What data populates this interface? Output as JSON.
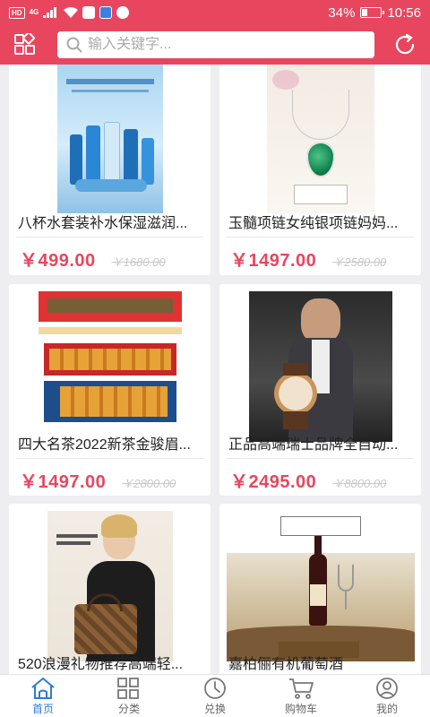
{
  "status_bar": {
    "hd": "HD",
    "network": "4G",
    "battery_percent": "34%",
    "battery_level": 0.34,
    "time": "10:56"
  },
  "header": {
    "search_placeholder": "输入关键字..."
  },
  "products": [
    {
      "title": "八杯水套装补水保湿滋润...",
      "price": "￥499.00",
      "old_price": "￥1680.00"
    },
    {
      "title": "玉髓项链女纯银项链妈妈...",
      "price": "￥1497.00",
      "old_price": "￥2580.00"
    },
    {
      "title": "四大名茶2022新茶金骏眉...",
      "price": "￥1497.00",
      "old_price": "￥2800.00"
    },
    {
      "title": "正品高端瑞士品牌全自动...",
      "price": "￥2495.00",
      "old_price": "￥8800.00"
    },
    {
      "title": "520浪漫礼物推荐高端轻...",
      "price": "",
      "old_price": ""
    },
    {
      "title": "嘉柏俪有机葡萄酒",
      "price": "",
      "old_price": ""
    }
  ],
  "bottom_nav": [
    {
      "label": "首页",
      "icon": "home-icon",
      "active": true
    },
    {
      "label": "分类",
      "icon": "category-icon",
      "active": false
    },
    {
      "label": "兑换",
      "icon": "exchange-icon",
      "active": false
    },
    {
      "label": "购物车",
      "icon": "cart-icon",
      "active": false
    },
    {
      "label": "我的",
      "icon": "profile-icon",
      "active": false
    }
  ],
  "colors": {
    "brand": "#e8465e",
    "price": "#e8465e",
    "active_nav": "#2e7bd6",
    "background": "#eeeef0"
  }
}
